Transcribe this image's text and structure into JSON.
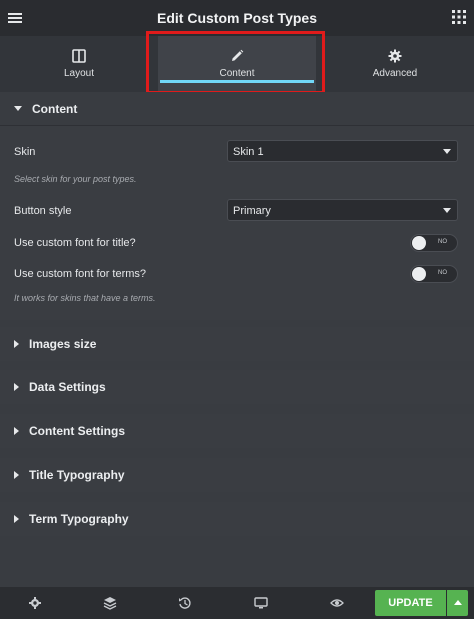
{
  "header": {
    "title": "Edit Custom Post Types"
  },
  "tabs": [
    {
      "label": "Layout",
      "icon": "columns-icon"
    },
    {
      "label": "Content",
      "icon": "pencil-icon"
    },
    {
      "label": "Advanced",
      "icon": "gear-icon"
    }
  ],
  "content": {
    "section_title": "Content",
    "skin_label": "Skin",
    "skin_value": "Skin 1",
    "skin_hint": "Select skin for your post types.",
    "button_style_label": "Button style",
    "button_style_value": "Primary",
    "custom_font_title_label": "Use custom font for title?",
    "custom_font_title_state": "NO",
    "custom_font_terms_label": "Use custom font for terms?",
    "custom_font_terms_state": "NO",
    "terms_hint": "It works for skins that have a terms."
  },
  "sections": [
    {
      "label": "Images size"
    },
    {
      "label": "Data Settings"
    },
    {
      "label": "Content Settings"
    },
    {
      "label": "Title Typography"
    },
    {
      "label": "Term Typography"
    }
  ],
  "footer": {
    "update_label": "UPDATE",
    "icons": [
      "gear-icon",
      "layers-icon",
      "history-icon",
      "desktop-icon",
      "eye-icon"
    ]
  },
  "colors": {
    "accent": "#71d7f7",
    "update_button": "#56b351",
    "highlight_border": "#e01b1b"
  }
}
